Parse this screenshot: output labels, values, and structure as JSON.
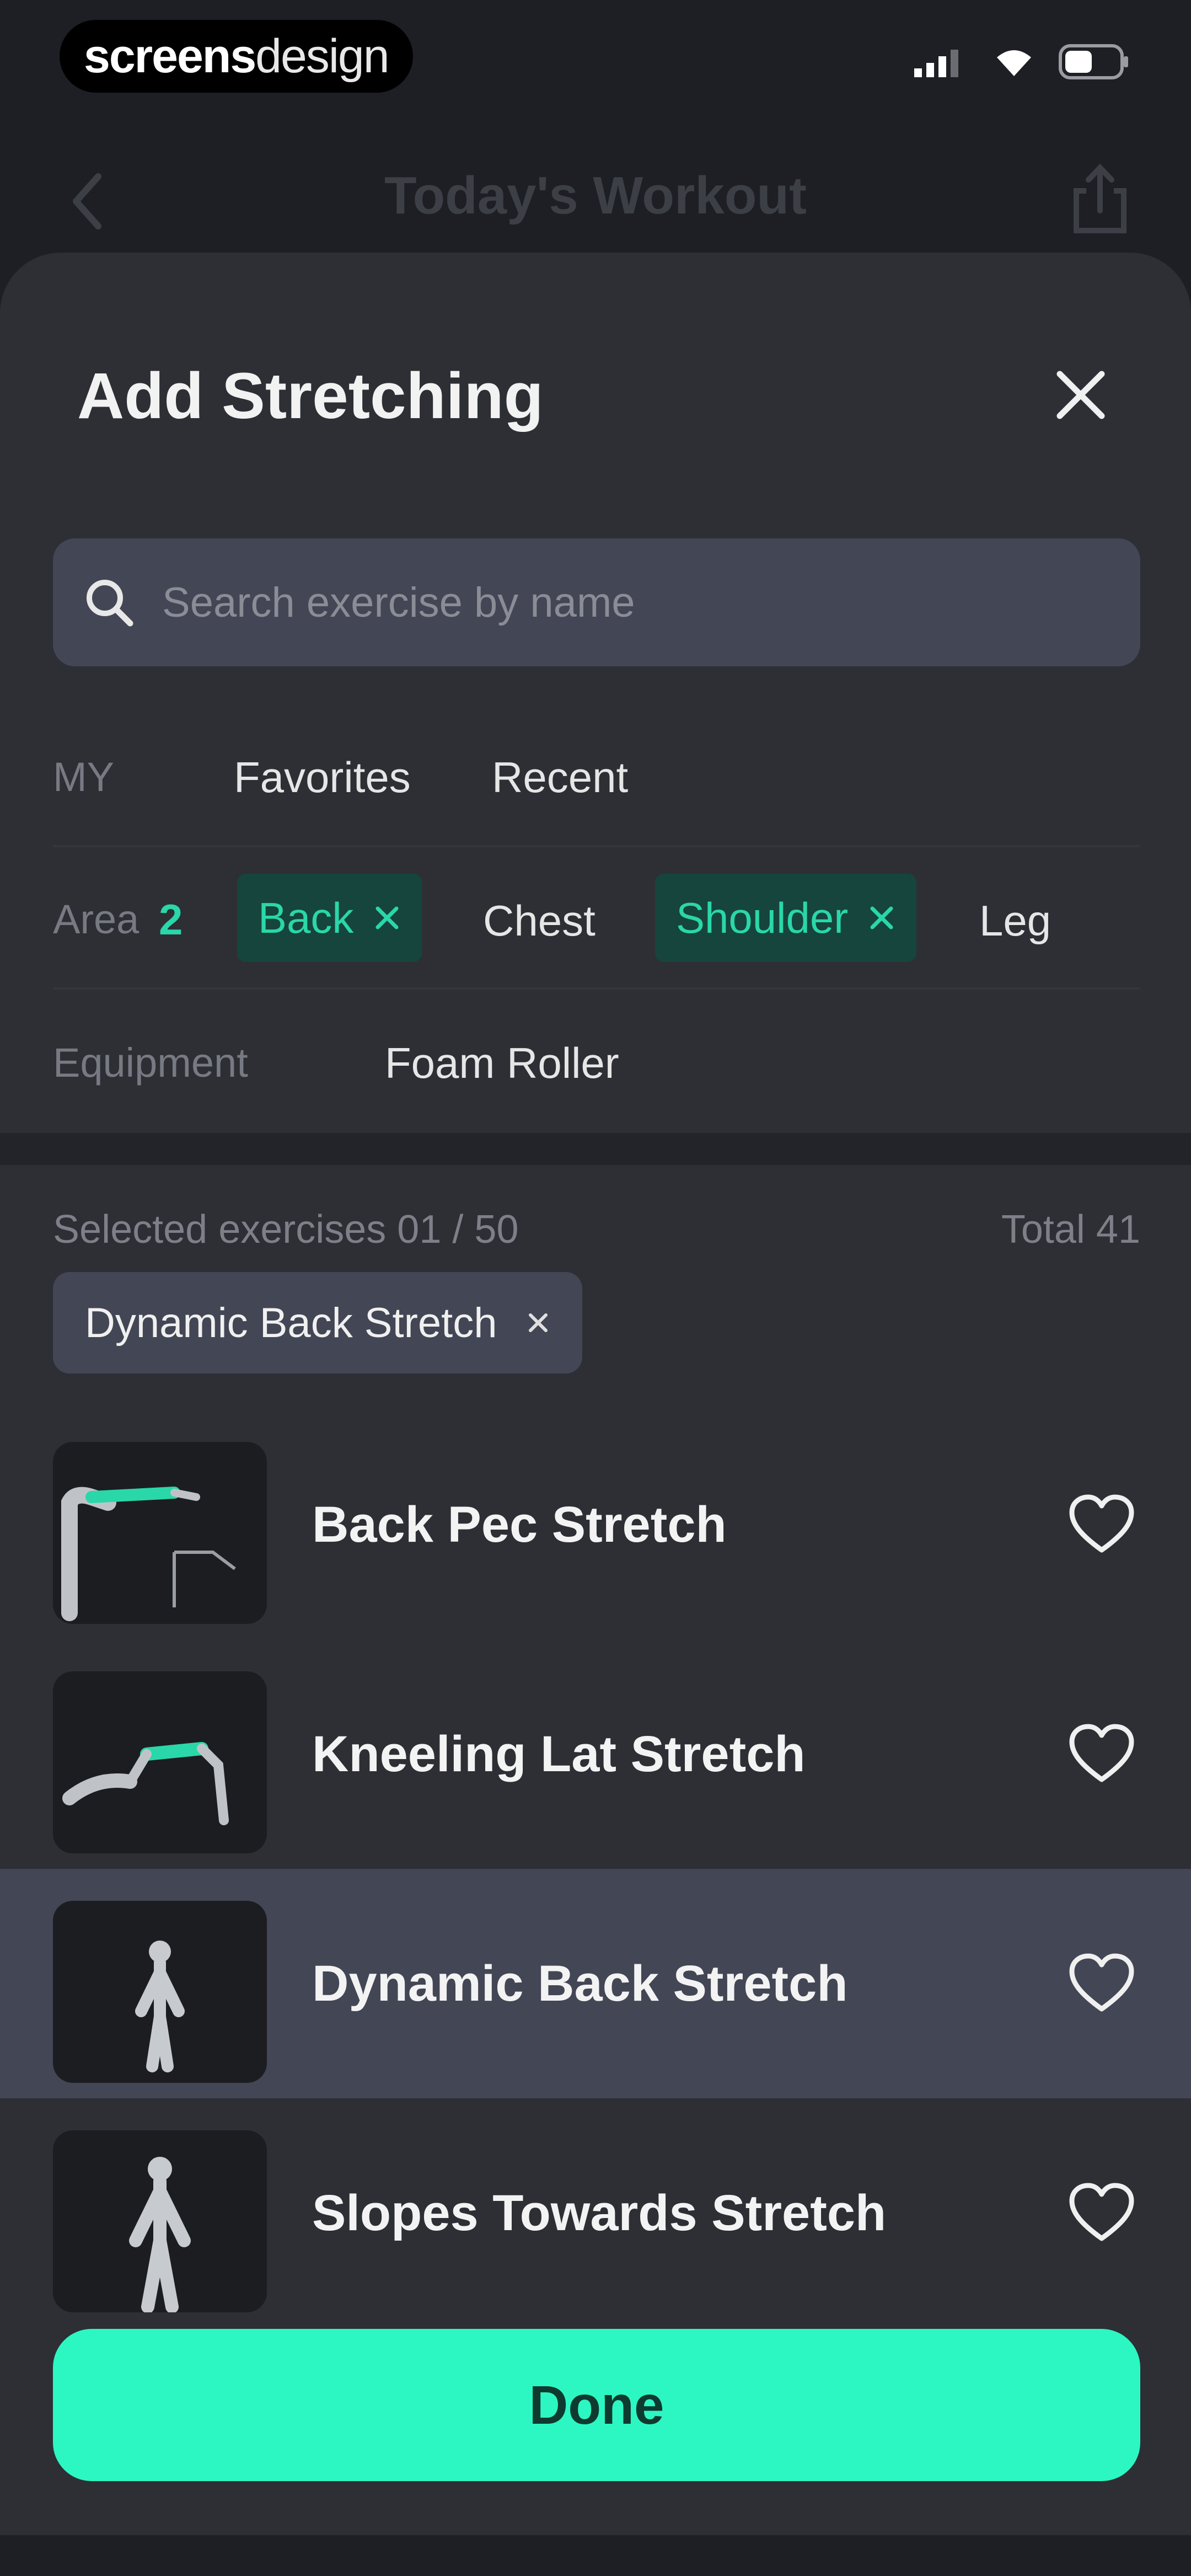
{
  "status_bar": {
    "brand_bold": "screens",
    "brand_light": "design",
    "icons": [
      "signal-icon",
      "wifi-icon",
      "battery-icon"
    ]
  },
  "background_header": {
    "title": "Today's Workout",
    "icons": [
      "back-chevron-icon",
      "share-icon"
    ]
  },
  "sheet": {
    "title": "Add Stretching",
    "close_icon": "close-icon",
    "search": {
      "placeholder": "Search exercise by name",
      "value": ""
    },
    "filters": {
      "my": {
        "label": "MY",
        "options": [
          "Favorites",
          "Recent"
        ]
      },
      "area": {
        "label": "Area",
        "selected_count": "2",
        "options": [
          {
            "label": "Back",
            "selected": true
          },
          {
            "label": "Chest",
            "selected": false
          },
          {
            "label": "Shoulder",
            "selected": true
          },
          {
            "label": "Leg",
            "selected": false
          }
        ]
      },
      "equipment": {
        "label": "Equipment",
        "options": [
          "Foam Roller"
        ]
      }
    },
    "selected_text": "Selected exercises 01 / 50",
    "total_text": "Total 41",
    "selected_chips": [
      "Dynamic Back Stretch"
    ],
    "exercises": [
      {
        "name": "Back Pec Stretch",
        "favorite": false,
        "highlighted": false
      },
      {
        "name": "Kneeling Lat Stretch",
        "favorite": false,
        "highlighted": false
      },
      {
        "name": "Dynamic Back Stretch",
        "favorite": false,
        "highlighted": true
      },
      {
        "name": "Slopes Towards Stretch",
        "favorite": false,
        "highlighted": false
      }
    ],
    "done_label": "Done"
  },
  "colors": {
    "accent": "#2cf7c2",
    "chip_bg": "#16453d",
    "chip_text": "#2ad7a8",
    "sheet_bg": "#2d2f35",
    "field_bg": "#434654"
  }
}
